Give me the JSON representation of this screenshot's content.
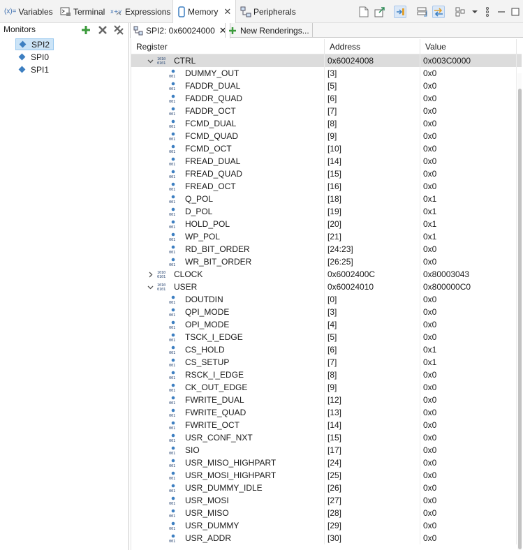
{
  "top_tabs": [
    {
      "label": "Variables",
      "icon": "variables-icon"
    },
    {
      "label": "Terminal",
      "icon": "terminal-icon"
    },
    {
      "label": "Expressions",
      "icon": "expressions-icon"
    },
    {
      "label": "Memory",
      "icon": "memory-icon",
      "active": true
    },
    {
      "label": "Peripherals",
      "icon": "peripherals-icon"
    }
  ],
  "variables_prefix": "(x)=",
  "monitors": {
    "header": "Monitors",
    "items": [
      "SPI2",
      "SPI0",
      "SPI1"
    ],
    "selected": "SPI2"
  },
  "renderings": {
    "active_tab": "SPI2: 0x60024000",
    "new_tab": "New Renderings..."
  },
  "table": {
    "columns": [
      "Register",
      "Address",
      "Value"
    ],
    "rows": [
      {
        "kind": "group",
        "expanded": true,
        "name": "CTRL",
        "address": "0x60024008",
        "value": "0x003C0000",
        "highlight": true
      },
      {
        "kind": "field",
        "name": "DUMMY_OUT",
        "address": "[3]",
        "value": "0x0"
      },
      {
        "kind": "field",
        "name": "FADDR_DUAL",
        "address": "[5]",
        "value": "0x0"
      },
      {
        "kind": "field",
        "name": "FADDR_QUAD",
        "address": "[6]",
        "value": "0x0"
      },
      {
        "kind": "field",
        "name": "FADDR_OCT",
        "address": "[7]",
        "value": "0x0"
      },
      {
        "kind": "field",
        "name": "FCMD_DUAL",
        "address": "[8]",
        "value": "0x0"
      },
      {
        "kind": "field",
        "name": "FCMD_QUAD",
        "address": "[9]",
        "value": "0x0"
      },
      {
        "kind": "field",
        "name": "FCMD_OCT",
        "address": "[10]",
        "value": "0x0"
      },
      {
        "kind": "field",
        "name": "FREAD_DUAL",
        "address": "[14]",
        "value": "0x0"
      },
      {
        "kind": "field",
        "name": "FREAD_QUAD",
        "address": "[15]",
        "value": "0x0"
      },
      {
        "kind": "field",
        "name": "FREAD_OCT",
        "address": "[16]",
        "value": "0x0"
      },
      {
        "kind": "field",
        "name": "Q_POL",
        "address": "[18]",
        "value": "0x1"
      },
      {
        "kind": "field",
        "name": "D_POL",
        "address": "[19]",
        "value": "0x1"
      },
      {
        "kind": "field",
        "name": "HOLD_POL",
        "address": "[20]",
        "value": "0x1"
      },
      {
        "kind": "field",
        "name": "WP_POL",
        "address": "[21]",
        "value": "0x1"
      },
      {
        "kind": "field",
        "name": "RD_BIT_ORDER",
        "address": "[24:23]",
        "value": "0x0"
      },
      {
        "kind": "field",
        "name": "WR_BIT_ORDER",
        "address": "[26:25]",
        "value": "0x0"
      },
      {
        "kind": "group",
        "expanded": false,
        "name": "CLOCK",
        "address": "0x6002400C",
        "value": "0x80003043"
      },
      {
        "kind": "group",
        "expanded": true,
        "name": "USER",
        "address": "0x60024010",
        "value": "0x800000C0"
      },
      {
        "kind": "field",
        "name": "DOUTDIN",
        "address": "[0]",
        "value": "0x0"
      },
      {
        "kind": "field",
        "name": "QPI_MODE",
        "address": "[3]",
        "value": "0x0"
      },
      {
        "kind": "field",
        "name": "OPI_MODE",
        "address": "[4]",
        "value": "0x0"
      },
      {
        "kind": "field",
        "name": "TSCK_I_EDGE",
        "address": "[5]",
        "value": "0x0"
      },
      {
        "kind": "field",
        "name": "CS_HOLD",
        "address": "[6]",
        "value": "0x1"
      },
      {
        "kind": "field",
        "name": "CS_SETUP",
        "address": "[7]",
        "value": "0x1"
      },
      {
        "kind": "field",
        "name": "RSCK_I_EDGE",
        "address": "[8]",
        "value": "0x0"
      },
      {
        "kind": "field",
        "name": "CK_OUT_EDGE",
        "address": "[9]",
        "value": "0x0"
      },
      {
        "kind": "field",
        "name": "FWRITE_DUAL",
        "address": "[12]",
        "value": "0x0"
      },
      {
        "kind": "field",
        "name": "FWRITE_QUAD",
        "address": "[13]",
        "value": "0x0"
      },
      {
        "kind": "field",
        "name": "FWRITE_OCT",
        "address": "[14]",
        "value": "0x0"
      },
      {
        "kind": "field",
        "name": "USR_CONF_NXT",
        "address": "[15]",
        "value": "0x0"
      },
      {
        "kind": "field",
        "name": "SIO",
        "address": "[17]",
        "value": "0x0"
      },
      {
        "kind": "field",
        "name": "USR_MISO_HIGHPART",
        "address": "[24]",
        "value": "0x0"
      },
      {
        "kind": "field",
        "name": "USR_MOSI_HIGHPART",
        "address": "[25]",
        "value": "0x0"
      },
      {
        "kind": "field",
        "name": "USR_DUMMY_IDLE",
        "address": "[26]",
        "value": "0x0"
      },
      {
        "kind": "field",
        "name": "USR_MOSI",
        "address": "[27]",
        "value": "0x0"
      },
      {
        "kind": "field",
        "name": "USR_MISO",
        "address": "[28]",
        "value": "0x0"
      },
      {
        "kind": "field",
        "name": "USR_DUMMY",
        "address": "[29]",
        "value": "0x0"
      },
      {
        "kind": "field",
        "name": "USR_ADDR",
        "address": "[30]",
        "value": "0x0"
      }
    ]
  },
  "colors": {
    "accent": "#3d7fc1",
    "selection": "#cce4f7",
    "row_highlight": "#dcdcdc"
  }
}
